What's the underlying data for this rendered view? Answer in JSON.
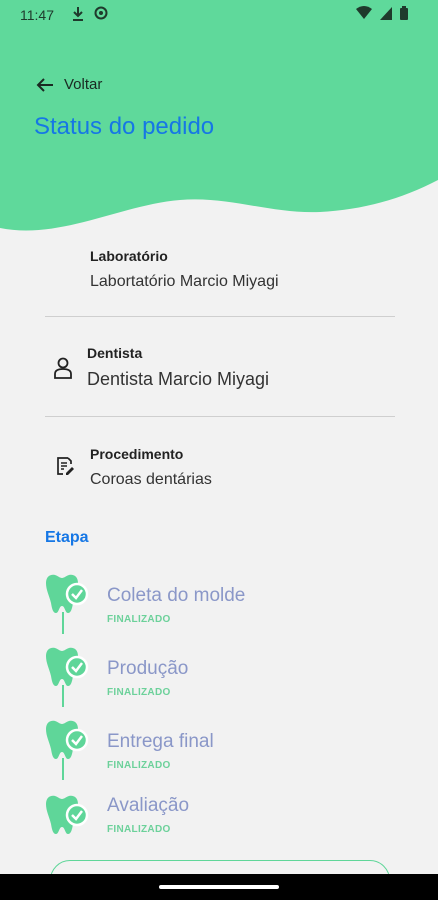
{
  "colors": {
    "header_green": "#5fd99b",
    "title_blue": "#1677e5",
    "step_text": "#8a97c8",
    "status_green": "#6cd19a"
  },
  "status_bar": {
    "time": "11:47",
    "left_icons": [
      "download-icon",
      "app-notification-icon"
    ],
    "right_icons": [
      "wifi-icon",
      "signal-icon",
      "battery-icon"
    ]
  },
  "header": {
    "back_label": "Voltar",
    "title": "Status do pedido"
  },
  "laboratorio": {
    "label": "Laboratório",
    "value": "Labortatório Marcio Miyagi"
  },
  "dentista": {
    "label": "Dentista",
    "value": "Dentista Marcio Miyagi",
    "icon": "person-icon"
  },
  "procedimento": {
    "label": "Procedimento",
    "value": "Coroas dentárias",
    "icon": "document-edit-icon"
  },
  "etapa": {
    "heading": "Etapa",
    "steps": [
      {
        "name": "Coleta do molde",
        "status": "FINALIZADO"
      },
      {
        "name": "Produção",
        "status": "FINALIZADO"
      },
      {
        "name": "Entrega final",
        "status": "FINALIZADO"
      },
      {
        "name": "Avaliação",
        "status": "FINALIZADO"
      }
    ]
  }
}
